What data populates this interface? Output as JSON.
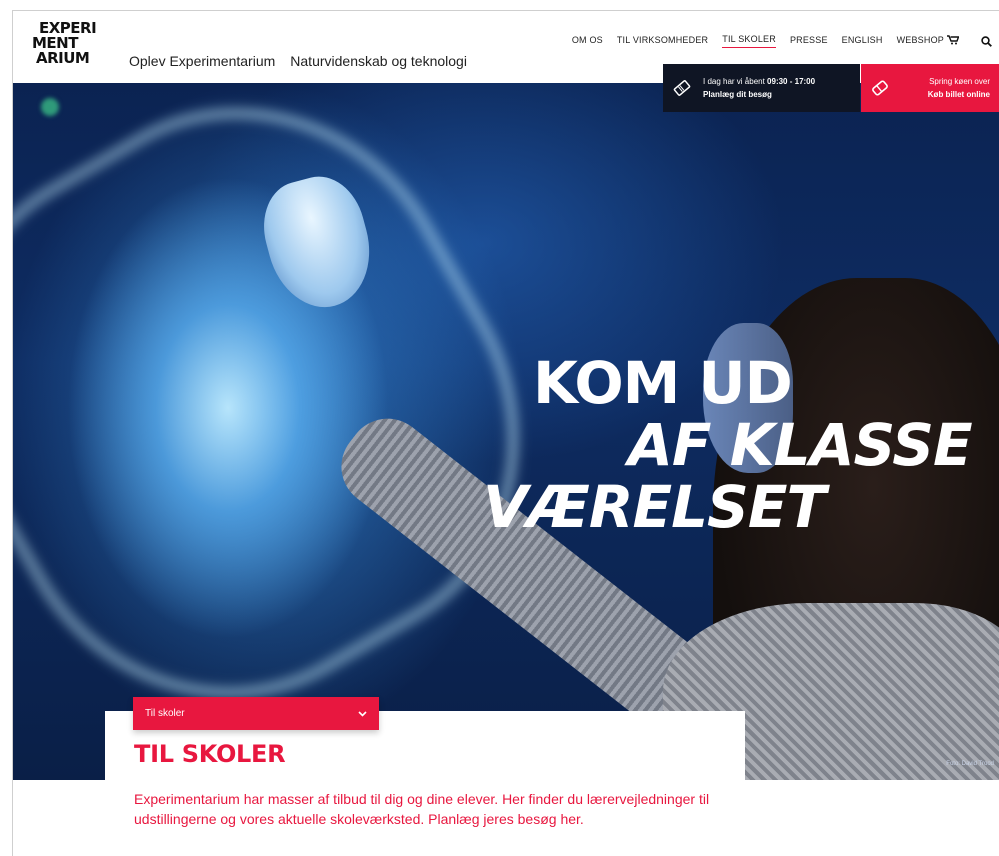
{
  "header": {
    "logo": [
      "EXPERI",
      "MENT",
      "ARIUM"
    ],
    "subnav": [
      "Oplev Experimentarium",
      "Naturvidenskab og teknologi"
    ],
    "topnav": [
      "OM OS",
      "TIL VIRKSOMHEDER",
      "TIL SKOLER",
      "PRESSE",
      "ENGLISH",
      "WEBSHOP"
    ],
    "active_topnav": "TIL SKOLER",
    "icons": [
      "cart-icon",
      "search-icon"
    ]
  },
  "info_bar": {
    "line1_prefix": "I dag har vi åbent ",
    "hours": "09:30 - 17:00",
    "line2": "Planlæg dit besøg",
    "icon": "ticket-icon"
  },
  "buy_bar": {
    "line1": "Spring køen over",
    "line2": "Køb billet online",
    "icon": "eraser-ticket-icon"
  },
  "hero": {
    "headline": [
      "KOM UD",
      "AF KLASSE",
      "VÆRELSET"
    ],
    "photo_credit": "Foto: David Trood"
  },
  "section": {
    "dropdown_label": "Til skoler",
    "title": "TIL SKOLER",
    "body": "Experimentarium har masser af tilbud til dig og dine elever. Her finder du lærervejledninger til udstillingerne og vores aktuelle skoleværksted. Planlæg jeres besøg her."
  },
  "colors": {
    "accent": "#e8173f",
    "dark": "#0f1524",
    "text": "#111111"
  }
}
